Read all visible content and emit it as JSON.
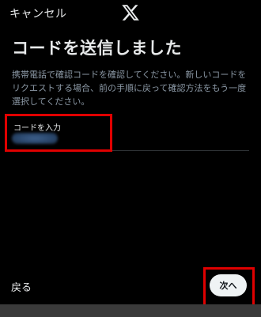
{
  "header": {
    "cancel_label": "キャンセル",
    "logo_icon": "x-logo-icon"
  },
  "main": {
    "title": "コードを送信しました",
    "description": "携帯電話で確認コードを確認してください。新しいコードをリクエストする場合、前の手順に戻って確認方法をもう一度選択してください。",
    "code_input": {
      "label": "コードを入力",
      "value_state": "redacted"
    }
  },
  "footer": {
    "back_label": "戻る",
    "next_label": "次へ"
  },
  "colors": {
    "background": "#000000",
    "highlight": "#e00000",
    "next_button_bg": "#eff3f4",
    "muted_text": "#8b98a5"
  }
}
